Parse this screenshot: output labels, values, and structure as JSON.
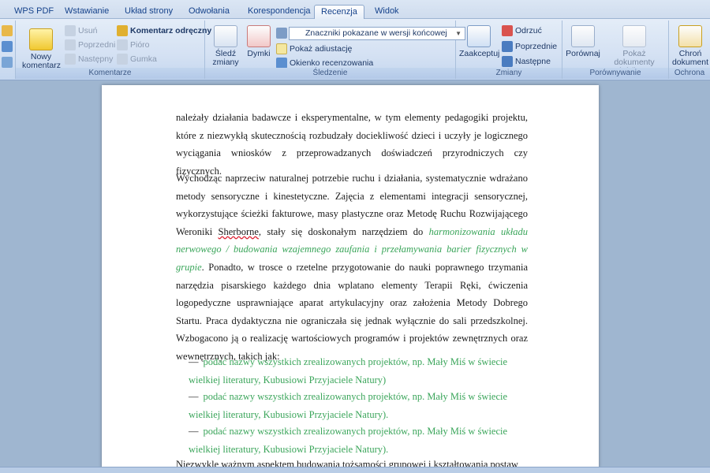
{
  "tabs": [
    "WPS PDF",
    "Wstawianie",
    "Układ strony",
    "Odwołania",
    "Korespondencja",
    "Recenzja",
    "Widok"
  ],
  "active_tab": "Recenzja",
  "ribbon": {
    "komentarze": {
      "new_comment": "Nowy komentarz",
      "delete": "Usuń",
      "previous": "Poprzedni",
      "next": "Następny",
      "handwritten": "Komentarz odręczny",
      "pen": "Pióro",
      "eraser": "Gumka",
      "label": "Komentarze"
    },
    "sledzenie": {
      "track": "Śledź zmiany",
      "balloons": "Dymki",
      "markup_dropdown": "Znaczniki pokazane w wersji końcowej",
      "show_markup": "Pokaż adiustację",
      "review_pane": "Okienko recenzowania",
      "label": "Śledzenie"
    },
    "zmiany": {
      "accept": "Zaakceptuj",
      "reject": "Odrzuć",
      "previous": "Poprzednie",
      "next": "Następne",
      "label": "Zmiany"
    },
    "porownywanie": {
      "compare": "Porównaj",
      "show_source": "Pokaż dokumenty źródłowe",
      "label": "Porównywanie"
    },
    "ochrona": {
      "protect": "Chroń dokument",
      "label": "Ochrona"
    }
  },
  "document": {
    "para1": "należały działania badawcze i eksperymentalne, w tym elementy pedagogiki projektu, które z niezwykłą skutecznością rozbudzały dociekliwość dzieci i uczyły je logicznego wyciągania wniosków z przeprowadzanych doświadczeń przyrodniczych czy fizycznych.",
    "para2_a": "Wychodząc naprzeciw naturalnej potrzebie ruchu i działania, systematycznie wdrażano metody sensoryczne i kinestetyczne. Zajęcia z elementami integracji sensorycznej, wykorzystujące ścieżki fakturowe, masy plastyczne oraz Metodę Ruchu Rozwijającego Weroniki ",
    "para2_sherborne": "Sherborne",
    "para2_b": ", stały się doskonałym narzędziem do ",
    "para2_green": "harmonizowania układu nerwowego / budowania wzajemnego zaufania i przełamywania barier fizycznych w grupie",
    "para2_c": ". Ponadto, w trosce o rzetelne przygotowanie do nauki poprawnego trzymania narzędzia pisarskiego każdego dnia wplatano elementy Terapii Ręki, ćwiczenia logopedyczne usprawniające aparat artykulacyjny oraz założenia Metody Dobrego Startu. Praca dydaktyczna nie ograniczała się jednak wyłącznie do sali przedszkolnej. Wzbogacono ją o realizację wartościowych programów i projektów zewnętrznych oraz wewnętrznych, takich jak:",
    "bullets": [
      "podać nazwy wszystkich zrealizowanych projektów, np. Mały Miś w świecie wielkiej literatury, Kubusiowi Przyjaciele Natury)",
      "podać nazwy wszystkich zrealizowanych projektów, np. Mały Miś w świecie wielkiej literatury, Kubusiowi Przyjaciele Natury).",
      "podać nazwy wszystkich zrealizowanych projektów, np. Mały Miś w świecie wielkiej literatury, Kubusiowi Przyjaciele Natury)."
    ],
    "bullet_dash": "—",
    "para3": "Niezwykle ważnym aspektem budowania tożsamości grupowej i kształtowania postaw"
  }
}
